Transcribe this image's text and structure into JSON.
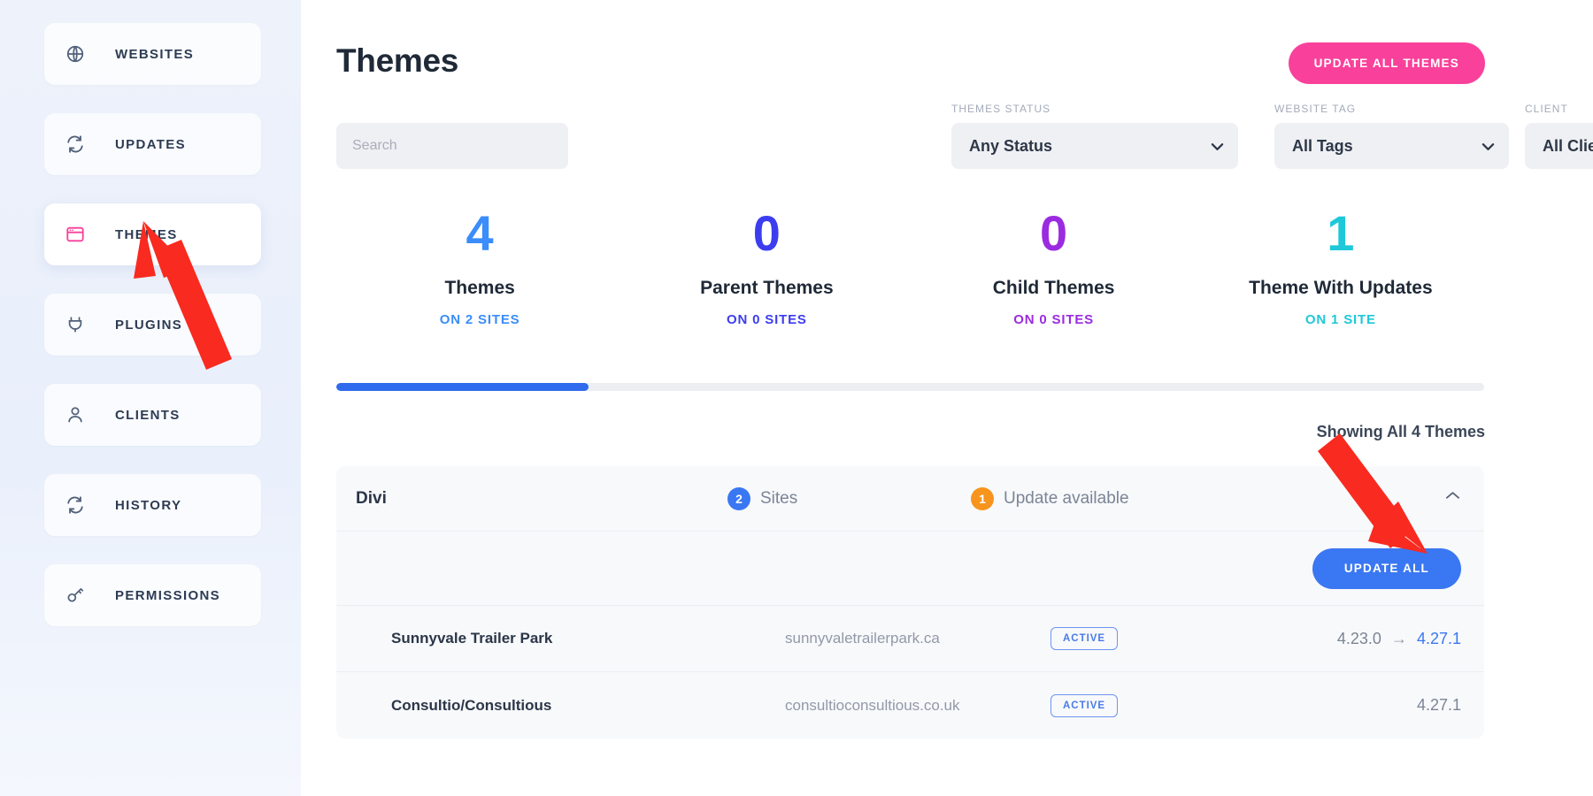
{
  "sidebar": {
    "items": [
      {
        "label": "WEBSITES",
        "icon": "globe-icon",
        "active": false
      },
      {
        "label": "UPDATES",
        "icon": "refresh-icon",
        "active": false
      },
      {
        "label": "THEMES",
        "icon": "layout-icon",
        "active": true
      },
      {
        "label": "PLUGINS",
        "icon": "plug-icon",
        "active": false
      },
      {
        "label": "CLIENTS",
        "icon": "user-icon",
        "active": false
      },
      {
        "label": "HISTORY",
        "icon": "refresh-icon",
        "active": false
      },
      {
        "label": "PERMISSIONS",
        "icon": "key-icon",
        "active": false
      }
    ]
  },
  "header": {
    "title": "Themes",
    "update_all_themes_label": "UPDATE ALL THEMES"
  },
  "filters": {
    "search": {
      "placeholder": "Search",
      "value": ""
    },
    "favorite_icon": "star-icon",
    "themes_status": {
      "label": "THEMES STATUS",
      "selected": "Any Status",
      "options": [
        "Any Status"
      ]
    },
    "website_tag": {
      "label": "WEBSITE TAG",
      "selected": "All Tags",
      "options": [
        "All Tags"
      ]
    },
    "client": {
      "label": "CLIENT",
      "selected": "All Clients",
      "options": [
        "All Clients"
      ]
    }
  },
  "stats": [
    {
      "value": "4",
      "name": "Themes",
      "sub": "ON 2 SITES",
      "color": "#3a8dfa"
    },
    {
      "value": "0",
      "name": "Parent Themes",
      "sub": "ON 0 SITES",
      "color": "#3d3df0"
    },
    {
      "value": "0",
      "name": "Child Themes",
      "sub": "ON 0 SITES",
      "color": "#9b2be0"
    },
    {
      "value": "1",
      "name": "Theme With Updates",
      "sub": "ON 1 SITE",
      "color": "#1fc8d8"
    }
  ],
  "progress": {
    "percent": 22,
    "fill_color": "#2f6bec",
    "track_color": "#eceef2"
  },
  "showing_count": "Showing All 4 Themes",
  "theme_card": {
    "name": "Divi",
    "sites_count": "2",
    "sites_label": "Sites",
    "updates_count": "1",
    "updates_label": "Update available",
    "collapse_icon": "chevron-up-icon",
    "update_all_label": "UPDATE ALL",
    "sites": [
      {
        "name": "Sunnyvale Trailer Park",
        "url": "sunnyvaletrailerpark.ca",
        "status": "ACTIVE",
        "version_current": "4.23.0",
        "version_arrow": "→",
        "version_new": "4.27.1"
      },
      {
        "name": "Consultio/Consultious",
        "url": "consultioconsultious.co.uk",
        "status": "ACTIVE",
        "version_current": "",
        "version_arrow": "",
        "version_new": "4.27.1"
      }
    ]
  },
  "annotations": {
    "arrow_color": "#f92a1f",
    "arrows": [
      {
        "name": "arrow-pointing-to-themes-nav"
      },
      {
        "name": "arrow-pointing-to-update-all-button"
      }
    ]
  }
}
